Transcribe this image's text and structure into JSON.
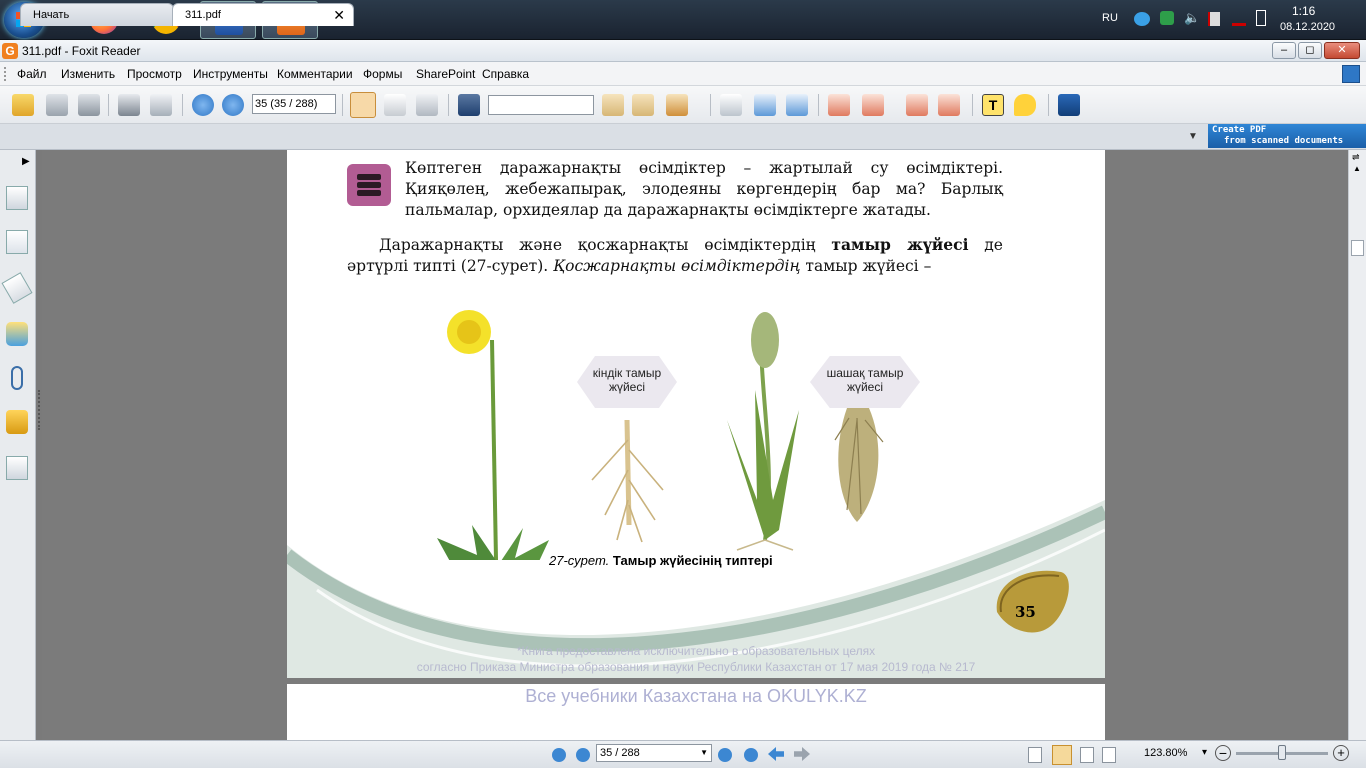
{
  "taskbar": {
    "apps": [
      "firefox",
      "chrome",
      "word",
      "foxit"
    ],
    "tray": {
      "language": "RU",
      "time": "1:16",
      "date": "08.12.2020"
    }
  },
  "window": {
    "title": "311.pdf - Foxit Reader",
    "app_icon": "G"
  },
  "menu": {
    "items": [
      "Файл",
      "Изменить",
      "Просмотр",
      "Инструменты",
      "Комментарии",
      "Формы",
      "SharePoint",
      "Справка"
    ]
  },
  "toolbar": {
    "page_value": "35 (35 / 288)",
    "find_value": ""
  },
  "tabs": [
    {
      "label": "Начать"
    },
    {
      "label": "311.pdf",
      "close": "✕"
    }
  ],
  "create_banner": {
    "line1": "Create PDF",
    "line2": "from scanned documents"
  },
  "document": {
    "intro_paragraph": "Көптеген даражарнақты өсімдіктер – жартылай су өсімдіктері. Қияқөлең, жебежапырақ, элодеяны көргендерің бар ма? Барлық пальмалар, орхидея­лар да даражарнақты өсімдіктерге жатады.",
    "para2_a": "Даражарнақты және қосжарнақты өсімдіктердің ",
    "para2_bold": "тамыр жүйесі",
    "para2_b": " де әртүрлі типті (27-сурет). ",
    "para2_italic": "Қосжарнақты өсімдіктердің",
    "para2_c": " тамыр жүйесі –",
    "bubble_left": "кіндік тамыр жүйесі",
    "bubble_right": "шашақ тамыр жүйесі",
    "caption_italic": "27-сурет.",
    "caption_bold": " Тамыр жүйесінің типтері",
    "page_number": "35",
    "watermark_line1": "*Книга предоставлена исключительно в образовательных целях",
    "watermark_line2": "согласно Приказа Министра образования и науки Республики Казахстан от 17 мая 2019 года № 217",
    "watermark_big": "Все учебники Казахстана на OKULYK.KZ"
  },
  "statusbar": {
    "page_value": "35 / 288",
    "zoom": "123.80%",
    "zoom_level": 0.5
  }
}
